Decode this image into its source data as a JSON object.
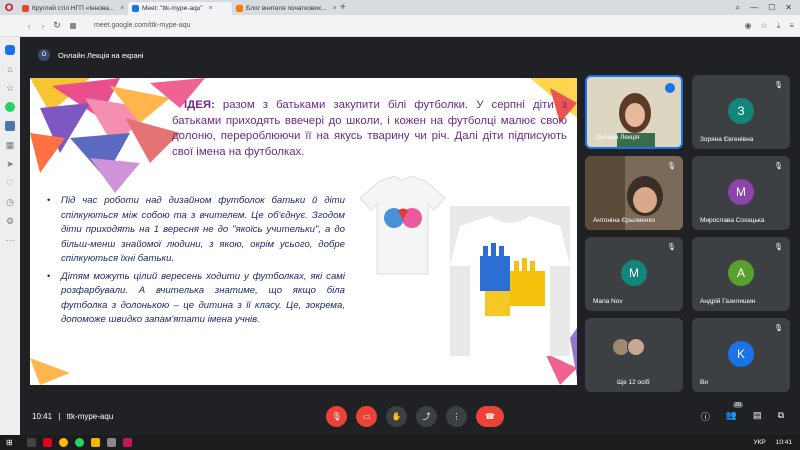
{
  "browser": {
    "tabs": [
      {
        "label": "Круглий стіл НГП «Іннова...",
        "color": "#ea4335"
      },
      {
        "label": "Meet: \"ttk-mype-aqu\"",
        "color": "#1a73e8"
      },
      {
        "label": "Блог вчителя початкових...",
        "color": "#f57c00"
      }
    ],
    "url": "meet.google.com/ttk-mype-aqu"
  },
  "meet": {
    "presenter_bar": "Онлайн Лекція на екрані",
    "presenter_initial": "О",
    "slide": {
      "heading": "ІДЕЯ:",
      "intro": " разом з батьками закупити білі футболки. У серпні діти з батьками приходять ввечері до школи, і кожен на футболці малює свою долоню, перероблюючи її на якусь тварину чи річ. Далі діти підписують свої імена на футболках.",
      "bullet1": "Під час роботи над дизайном футболок батьки й діти спілкуються між собою та з вчителем. Це об'єднує. Згодом діти приходять на 1 вересня не до \"якоїсь учительки\", а до більш-менш знайомої людини, з якою, окрім усього, добре спілкуються їхні батьки.",
      "bullet2": "Дітям можуть цілий вересень ходити у футболках, які самі розфарбували. А вчителька знатиме, що якщо біла футболка з долонькою – це дитина з її класу. Це, зокрема, допоможе швидко запам'ятати імена учнів."
    },
    "participants": [
      {
        "name": "Онлайн Лекція",
        "initial": "",
        "color": ""
      },
      {
        "name": "Зоряна Євгенівна",
        "initial": "З",
        "color": "#12867a"
      },
      {
        "name": "Антоніна Єрьоменко",
        "initial": "",
        "color": ""
      },
      {
        "name": "Мирослава Сохацька",
        "initial": "М",
        "color": "#8e44ad"
      },
      {
        "name": "Maria Nov",
        "initial": "M",
        "color": "#12867a"
      },
      {
        "name": "Андрій Газилишин",
        "initial": "А",
        "color": "#5aa02c"
      },
      {
        "name": "Ще 12 осіб",
        "initial": "",
        "color": ""
      },
      {
        "name": "Ви",
        "initial": "K",
        "color": "#1a73e8"
      }
    ],
    "time": "10:41",
    "separator": "|",
    "meeting_code": "ttk-mype-aqu",
    "people_count": "20"
  },
  "taskbar": {
    "lang": "УКР",
    "clock": "10:41"
  }
}
